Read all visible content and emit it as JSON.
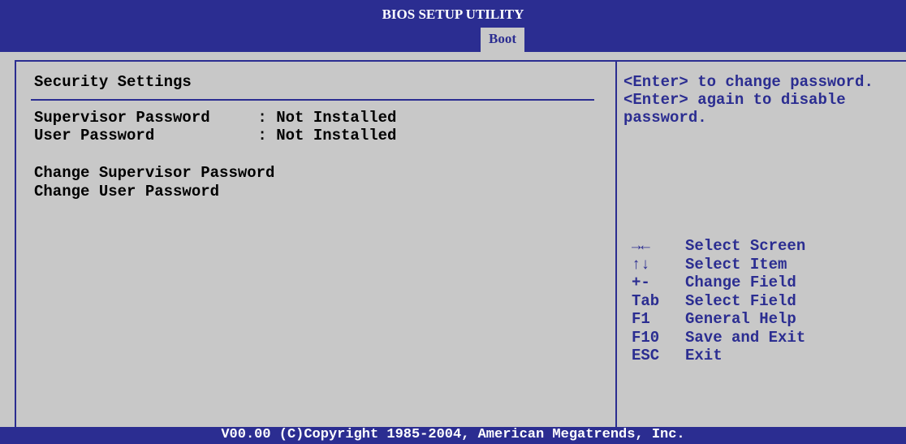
{
  "header": {
    "title": "BIOS SETUP UTILITY",
    "active_tab": "Boot"
  },
  "main": {
    "section_title": "Security Settings",
    "status_rows": [
      {
        "label": "Supervisor Password",
        "value": "Not Installed"
      },
      {
        "label": "User Password",
        "value": "Not Installed"
      }
    ],
    "menu_items": [
      {
        "label": "Change Supervisor Password"
      },
      {
        "label": "Change User Password"
      }
    ]
  },
  "help": {
    "lines": [
      "<Enter> to change password.",
      "<Enter> again to disable",
      "password."
    ]
  },
  "keys": [
    {
      "key": "→←",
      "action": "Select Screen"
    },
    {
      "key": "↑↓",
      "action": "Select Item"
    },
    {
      "key": "+-",
      "action": "Change Field"
    },
    {
      "key": "Tab",
      "action": "Select Field"
    },
    {
      "key": "F1",
      "action": "General Help"
    },
    {
      "key": "F10",
      "action": "Save and Exit"
    },
    {
      "key": "ESC",
      "action": "Exit"
    }
  ],
  "footer": {
    "copyright": "V00.00 (C)Copyright 1985-2004, American Megatrends, Inc."
  },
  "colors": {
    "background": "#c8c8c8",
    "accent_blue": "#2b2d91",
    "text_dark": "#000000",
    "text_light": "#ffffff"
  }
}
